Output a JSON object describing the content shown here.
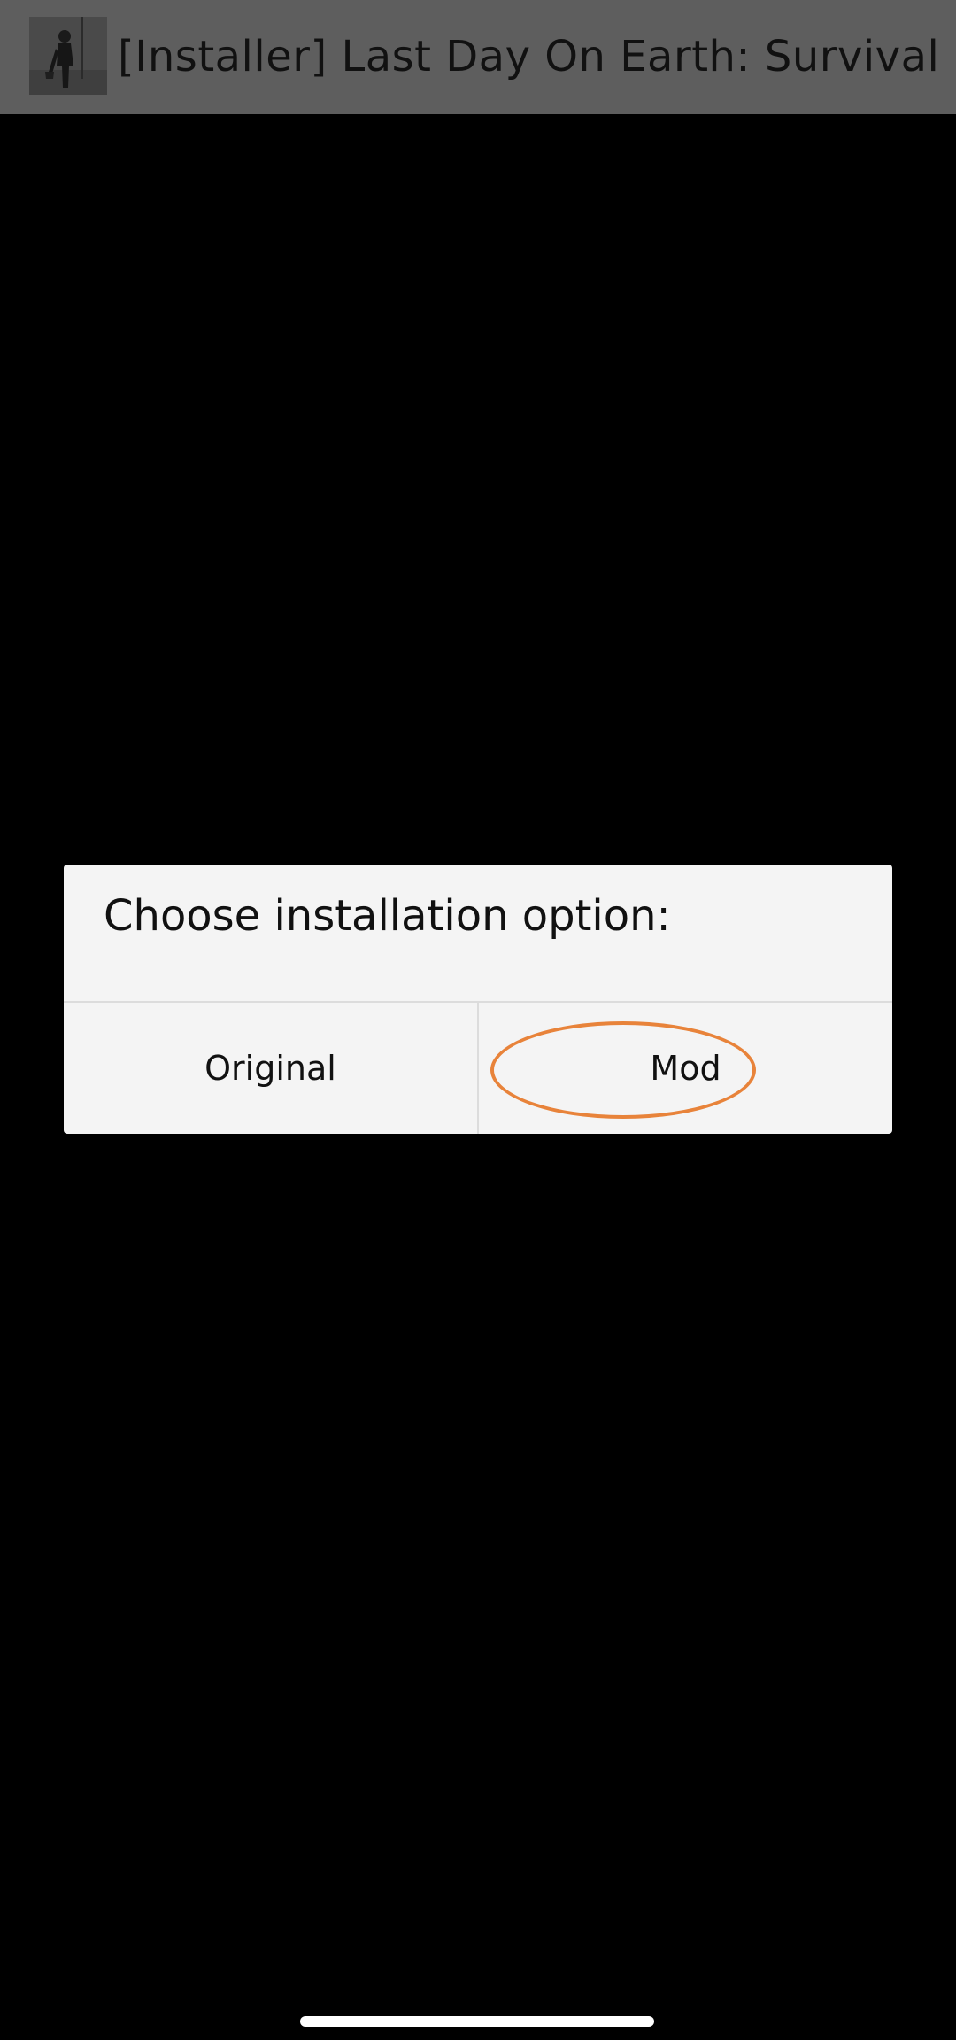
{
  "app_bar": {
    "title": "[Installer] Last Day On Earth: Survival",
    "icon": "app-thumbnail-icon"
  },
  "dialog": {
    "title": "Choose installation option:",
    "buttons": [
      {
        "label": "Original"
      },
      {
        "label": "Mod"
      }
    ]
  },
  "annotation": {
    "highlight_color": "#e8833a",
    "highlighted_option": "Mod"
  },
  "colors": {
    "app_bar_bg": "#5e5e5e",
    "dialog_bg": "#f4f4f4",
    "screen_bg": "#000000"
  }
}
